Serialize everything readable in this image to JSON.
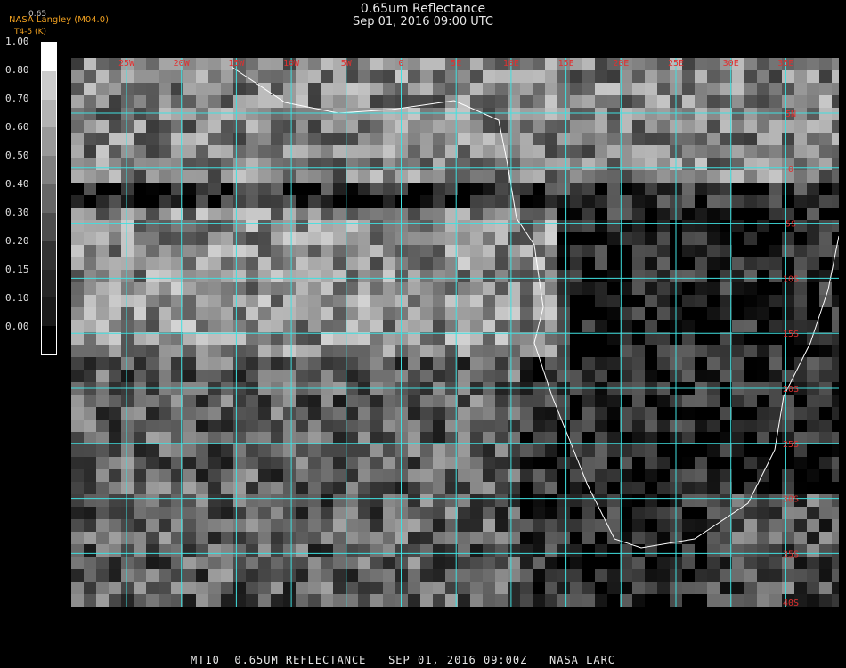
{
  "header": {
    "title": "0.65um Reflectance",
    "datetime": "Sep 01, 2016 09:00 UTC",
    "source": "NASA Langley (M04.0)",
    "sub": "T4-5 (K)",
    "tiny": "0.65"
  },
  "legend": {
    "labels": [
      "1.00",
      "0.80",
      "0.70",
      "0.60",
      "0.50",
      "0.40",
      "0.30",
      "0.20",
      "0.15",
      "0.10",
      "0.00"
    ],
    "gray_levels": [
      1.0,
      0.8,
      0.7,
      0.6,
      0.5,
      0.4,
      0.3,
      0.2,
      0.15,
      0.1,
      0.0
    ]
  },
  "map": {
    "lon_labels": [
      "25W",
      "20W",
      "15W",
      "10W",
      "5W",
      "0",
      "5E",
      "10E",
      "15E",
      "20E",
      "25E",
      "30E",
      "35E"
    ],
    "lat_labels": [
      "5N",
      "0",
      "5S",
      "10S",
      "15S",
      "20S",
      "25S",
      "30S",
      "35S",
      "40S"
    ],
    "grid_color": "#40e0e0",
    "label_color": "#e03030",
    "coast_color": "#ffffff"
  },
  "footer": "MT10  0.65UM REFLECTANCE   SEP 01, 2016 09:00Z   NASA LARC"
}
